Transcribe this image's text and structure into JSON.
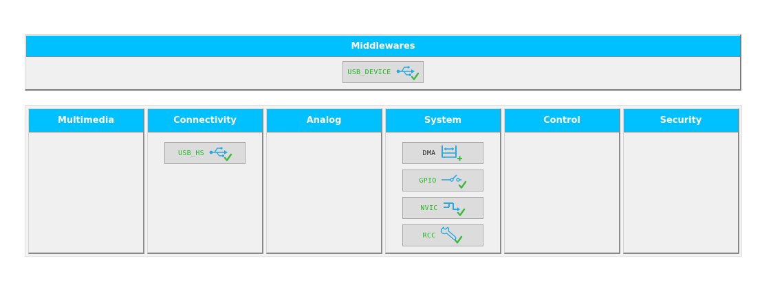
{
  "middlewares": {
    "title": "Middlewares",
    "items": [
      {
        "label": "USB_DEVICE",
        "icon": "usb-icon",
        "status": "configured"
      }
    ]
  },
  "categories": [
    {
      "title": "Multimedia",
      "items": []
    },
    {
      "title": "Connectivity",
      "items": [
        {
          "label": "USB_HS",
          "icon": "usb-icon",
          "status": "configured"
        }
      ]
    },
    {
      "title": "Analog",
      "items": []
    },
    {
      "title": "System",
      "items": [
        {
          "label": "DMA",
          "icon": "dma-icon",
          "status": "add"
        },
        {
          "label": "GPIO",
          "icon": "gpio-switch-icon",
          "status": "configured"
        },
        {
          "label": "NVIC",
          "icon": "nvic-icon",
          "status": "configured"
        },
        {
          "label": "RCC",
          "icon": "wrench-icon",
          "status": "configured"
        }
      ]
    },
    {
      "title": "Control",
      "items": []
    },
    {
      "title": "Security",
      "items": []
    }
  ],
  "colors": {
    "header_bg": "#00c0ff",
    "configured_text": "#1fb81f",
    "icon_blue": "#29a8e0",
    "check_green": "#3cb83c"
  }
}
